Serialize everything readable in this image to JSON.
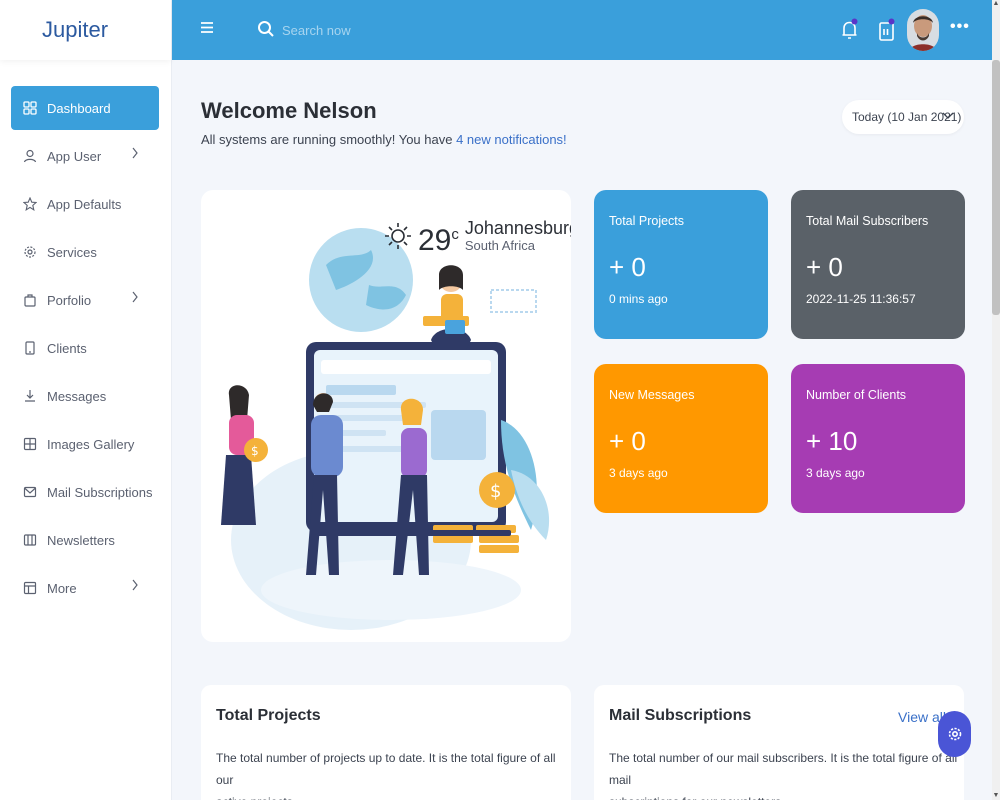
{
  "app": {
    "brand": "Jupiter"
  },
  "search": {
    "placeholder": "Search now"
  },
  "sidebar": {
    "items": [
      {
        "label": "Dashboard"
      },
      {
        "label": "App User"
      },
      {
        "label": "App Defaults"
      },
      {
        "label": "Services"
      },
      {
        "label": "Porfolio"
      },
      {
        "label": "Clients"
      },
      {
        "label": "Messages"
      },
      {
        "label": "Images Gallery"
      },
      {
        "label": "Mail Subscriptions"
      },
      {
        "label": "Newsletters"
      },
      {
        "label": "More"
      }
    ]
  },
  "header": {
    "welcome": "Welcome Nelson",
    "subtitle_prefix": "All systems are running smoothly! You have ",
    "subtitle_link": "4 new notifications!",
    "date_dropdown": "Today (10 Jan 2021)"
  },
  "weather": {
    "temp": "29",
    "unit": "c",
    "city": "Johannesburg",
    "country": "South Africa"
  },
  "stats": [
    {
      "title": "Total Projects",
      "value": "+ 0",
      "time": "0 mins ago",
      "color": "#3a9fdb"
    },
    {
      "title": "Total Mail Subscribers",
      "value": "+ 0",
      "time": "2022-11-25 11:36:57",
      "color": "#5a6168"
    },
    {
      "title": "New Messages",
      "value": "+ 0",
      "time": "3 days ago",
      "color": "#ff9800"
    },
    {
      "title": "Number of Clients",
      "value": "+ 10",
      "time": "3 days ago",
      "color": "#a63cb3"
    }
  ],
  "cards": {
    "projects": {
      "title": "Total Projects",
      "body_line1": "The total number of projects up to date. It is the total figure of all our",
      "body_line2": "active projects"
    },
    "mail": {
      "title": "Mail Subscriptions",
      "link": "View all",
      "body_line1": "The total number of our mail subscribers. It is the total figure of all mail",
      "body_line2": "subscriptions for our newsletters"
    }
  },
  "colors": {
    "primary": "#3a9fdb",
    "accent_link": "#3a70c8",
    "fab": "#4a55d6"
  }
}
